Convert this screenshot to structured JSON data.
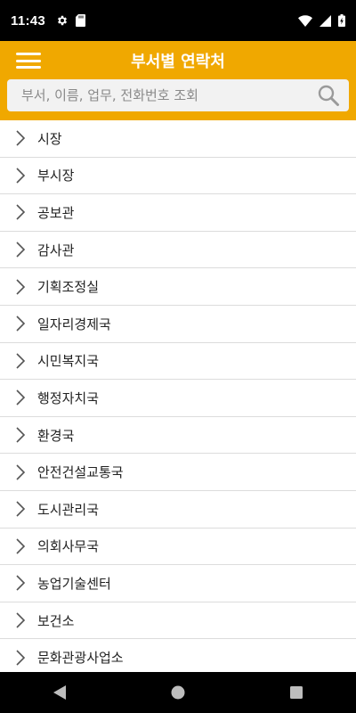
{
  "status_bar": {
    "time": "11:43",
    "left_icons": [
      "gear-icon",
      "sd-card-icon"
    ],
    "right_icons": [
      "wifi-icon",
      "signal-icon",
      "battery-icon"
    ]
  },
  "app_bar": {
    "title": "부서별 연락처",
    "menu_icon": "hamburger-menu-icon"
  },
  "search": {
    "placeholder": "부서, 이름, 업무, 전화번호 조회",
    "value": "",
    "icon": "search-icon"
  },
  "departments": [
    {
      "label": "시장"
    },
    {
      "label": "부시장"
    },
    {
      "label": "공보관"
    },
    {
      "label": "감사관"
    },
    {
      "label": "기획조정실"
    },
    {
      "label": "일자리경제국"
    },
    {
      "label": "시민복지국"
    },
    {
      "label": "행정자치국"
    },
    {
      "label": "환경국"
    },
    {
      "label": "안전건설교통국"
    },
    {
      "label": "도시관리국"
    },
    {
      "label": "의회사무국"
    },
    {
      "label": "농업기술센터"
    },
    {
      "label": "보건소"
    },
    {
      "label": "문화관광사업소"
    }
  ],
  "nav_bar": {
    "buttons": [
      "back-icon",
      "home-icon",
      "recents-icon"
    ]
  },
  "colors": {
    "accent": "#f0a800",
    "system_bar": "#000000"
  }
}
